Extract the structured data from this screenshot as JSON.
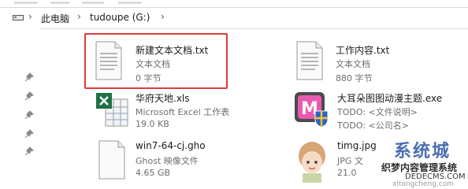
{
  "breadcrumb": {
    "items": [
      "此电脑",
      "tudoupe (G:)"
    ],
    "separator": "›"
  },
  "files": [
    {
      "name": "新建文本文档.txt",
      "type": "文本文档",
      "size": "0 字节",
      "icon": "text-file-icon",
      "selected": true
    },
    {
      "name": "工作内容.txt",
      "type": "文本文档",
      "size": "880 字节",
      "icon": "text-file-icon"
    },
    {
      "name": "华府天地.xls",
      "type": "Microsoft Excel 工作表",
      "size": "19.0 KB",
      "icon": "excel-file-icon"
    },
    {
      "name": "大耳朵图图动漫主题.exe",
      "type": "TODO: <文件说明>",
      "size": "TODO: <公司名>",
      "icon": "exe-app-icon"
    },
    {
      "name": "win7-64-cj.gho",
      "type": "Ghost 映像文件",
      "size": "4.65 GB",
      "icon": "generic-file-icon"
    },
    {
      "name": "timg.jpg",
      "type": "JPG 文",
      "size": "21.0",
      "icon": "image-thumbnail-icon"
    }
  ],
  "watermark": {
    "title": "系统城",
    "subtitle": "织梦内容管理系统",
    "url": "DEDECMS.COM",
    "url2": "xitongcheng.com"
  },
  "colors": {
    "highlight_border": "#e03a3a",
    "excel_green": "#1e7145",
    "watermark_blue": "#4a6fb0"
  }
}
